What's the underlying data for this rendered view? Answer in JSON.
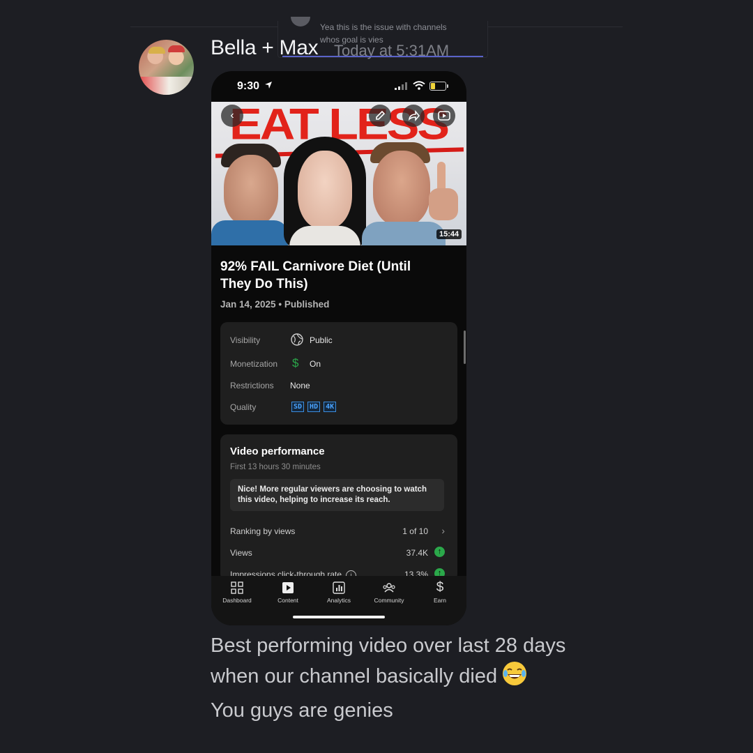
{
  "reply_preview": {
    "line1": "Yea this is the issue with channels",
    "line2": "whos goal is vies"
  },
  "message": {
    "author": "Bella + Max",
    "timestamp": "Today at 5:31AM",
    "text_line1": "Best performing video over last 28 days",
    "text_line2": "when our channel basically died",
    "text_line3": "You guys are genies"
  },
  "phone": {
    "status_time": "9:30",
    "thumbnail": {
      "overlay_text": "EAT LESS",
      "duration": "15:44"
    },
    "video": {
      "title": "92% FAIL Carnivore Diet (Until They Do This)",
      "date": "Jan 14, 2025",
      "status": "Published"
    },
    "details": {
      "visibility_label": "Visibility",
      "visibility_value": "Public",
      "monetization_label": "Monetization",
      "monetization_value": "On",
      "restrictions_label": "Restrictions",
      "restrictions_value": "None",
      "quality_label": "Quality",
      "quality_badges": [
        "SD",
        "HD",
        "4K"
      ]
    },
    "performance": {
      "title": "Video performance",
      "subtitle": "First 13 hours 30 minutes",
      "note": "Nice! More regular viewers are choosing to watch this video, helping to increase its reach.",
      "metrics": [
        {
          "label": "Ranking by views",
          "value": "1 of 10"
        },
        {
          "label": "Views",
          "value": "37.4K"
        },
        {
          "label": "Impressions click-through rate",
          "value": "13.3%"
        }
      ]
    },
    "tabs": [
      {
        "label": "Dashboard",
        "icon": "dashboard-icon"
      },
      {
        "label": "Content",
        "icon": "content-icon"
      },
      {
        "label": "Analytics",
        "icon": "analytics-icon"
      },
      {
        "label": "Community",
        "icon": "community-icon"
      },
      {
        "label": "Earn",
        "icon": "earn-icon"
      }
    ]
  },
  "colors": {
    "background": "#1d1e23",
    "up_indicator": "#2ba84a",
    "quality_badge": "#3b8ee0",
    "thumbnail_text": "#e2231a"
  }
}
